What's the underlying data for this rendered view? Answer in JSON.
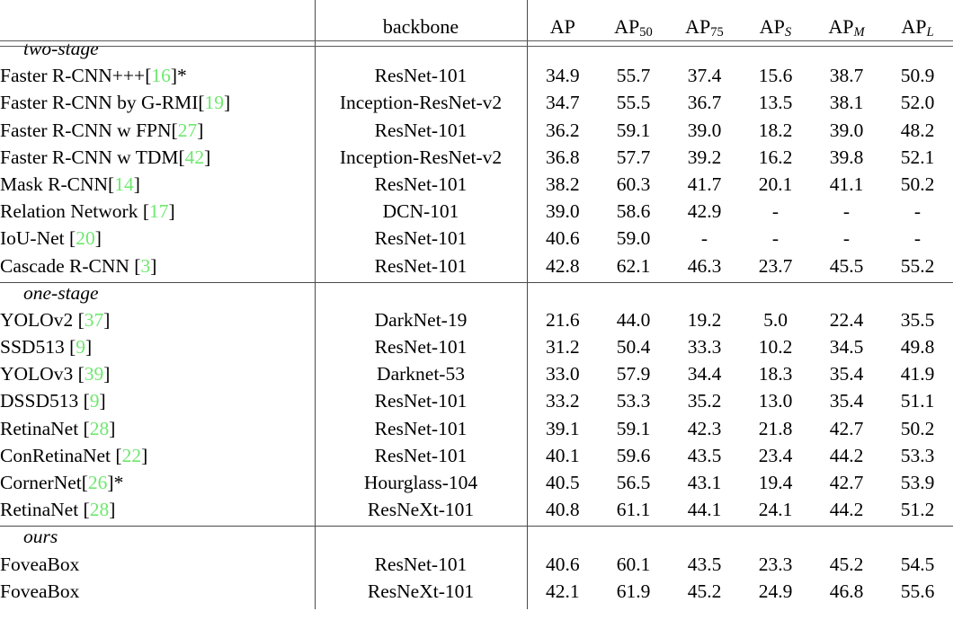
{
  "table": {
    "caption": "",
    "columns": [
      {
        "key": "method",
        "label": "",
        "align": "left"
      },
      {
        "key": "backbone",
        "label": "backbone",
        "align": "center"
      },
      {
        "key": "ap",
        "label": "AP",
        "sub": "",
        "align": "center"
      },
      {
        "key": "ap50",
        "label": "AP",
        "sub": "50",
        "align": "center"
      },
      {
        "key": "ap75",
        "label": "AP",
        "sub": "75",
        "align": "center"
      },
      {
        "key": "aps",
        "label": "AP",
        "sub": "S",
        "align": "center"
      },
      {
        "key": "apm",
        "label": "AP",
        "sub": "M",
        "align": "center"
      },
      {
        "key": "apl",
        "label": "AP",
        "sub": "L",
        "align": "center"
      }
    ],
    "header": {
      "backbone": "backbone",
      "ap": "AP",
      "ap50": "AP",
      "ap50_sub": "50",
      "ap75": "AP",
      "ap75_sub": "75",
      "aps": "AP",
      "aps_sub": "S",
      "apm": "AP",
      "apm_sub": "M",
      "apl": "AP",
      "apl_sub": "L"
    },
    "citation_color": "#6ee86e",
    "rule_color": "#4a4a4a",
    "groups": [
      {
        "label": "two-stage",
        "rows": [
          {
            "name": "Faster R-CNN+++",
            "cite": "16",
            "star": true,
            "space_before_cite": false,
            "backbone": "ResNet-101",
            "ap": "34.9",
            "ap50": "55.7",
            "ap75": "37.4",
            "aps": "15.6",
            "apm": "38.7",
            "apl": "50.9"
          },
          {
            "name": "Faster R-CNN by G-RMI",
            "cite": "19",
            "star": false,
            "space_before_cite": false,
            "backbone": "Inception-ResNet-v2",
            "ap": "34.7",
            "ap50": "55.5",
            "ap75": "36.7",
            "aps": "13.5",
            "apm": "38.1",
            "apl": "52.0"
          },
          {
            "name": "Faster R-CNN w FPN",
            "cite": "27",
            "star": false,
            "space_before_cite": false,
            "backbone": "ResNet-101",
            "ap": "36.2",
            "ap50": "59.1",
            "ap75": "39.0",
            "aps": "18.2",
            "apm": "39.0",
            "apl": "48.2"
          },
          {
            "name": "Faster R-CNN w TDM",
            "cite": "42",
            "star": false,
            "space_before_cite": false,
            "backbone": "Inception-ResNet-v2",
            "ap": "36.8",
            "ap50": "57.7",
            "ap75": "39.2",
            "aps": "16.2",
            "apm": "39.8",
            "apl": "52.1"
          },
          {
            "name": "Mask R-CNN",
            "cite": "14",
            "star": false,
            "space_before_cite": false,
            "backbone": "ResNet-101",
            "ap": "38.2",
            "ap50": "60.3",
            "ap75": "41.7",
            "aps": "20.1",
            "apm": "41.1",
            "apl": "50.2"
          },
          {
            "name": "Relation Network",
            "cite": "17",
            "star": false,
            "space_before_cite": true,
            "backbone": "DCN-101",
            "ap": "39.0",
            "ap50": "58.6",
            "ap75": "42.9",
            "aps": "-",
            "apm": "-",
            "apl": "-"
          },
          {
            "name": "IoU-Net",
            "cite": "20",
            "star": false,
            "space_before_cite": true,
            "backbone": "ResNet-101",
            "ap": "40.6",
            "ap50": "59.0",
            "ap75": "-",
            "aps": "-",
            "apm": "-",
            "apl": "-"
          },
          {
            "name": "Cascade R-CNN",
            "cite": "3",
            "star": false,
            "space_before_cite": true,
            "backbone": "ResNet-101",
            "ap": "42.8",
            "ap50": "62.1",
            "ap75": "46.3",
            "aps": "23.7",
            "apm": "45.5",
            "apl": "55.2"
          }
        ]
      },
      {
        "label": "one-stage",
        "rows": [
          {
            "name": "YOLOv2",
            "cite": "37",
            "star": false,
            "space_before_cite": true,
            "backbone": "DarkNet-19",
            "ap": "21.6",
            "ap50": "44.0",
            "ap75": "19.2",
            "aps": "5.0",
            "apm": "22.4",
            "apl": "35.5"
          },
          {
            "name": "SSD513",
            "cite": "9",
            "star": false,
            "space_before_cite": true,
            "backbone": "ResNet-101",
            "ap": "31.2",
            "ap50": "50.4",
            "ap75": "33.3",
            "aps": "10.2",
            "apm": "34.5",
            "apl": "49.8"
          },
          {
            "name": "YOLOv3",
            "cite": "39",
            "star": false,
            "space_before_cite": true,
            "backbone": "Darknet-53",
            "ap": "33.0",
            "ap50": "57.9",
            "ap75": "34.4",
            "aps": "18.3",
            "apm": "35.4",
            "apl": "41.9"
          },
          {
            "name": "DSSD513",
            "cite": "9",
            "star": false,
            "space_before_cite": true,
            "backbone": "ResNet-101",
            "ap": "33.2",
            "ap50": "53.3",
            "ap75": "35.2",
            "aps": "13.0",
            "apm": "35.4",
            "apl": "51.1"
          },
          {
            "name": "RetinaNet",
            "cite": "28",
            "star": false,
            "space_before_cite": true,
            "backbone": "ResNet-101",
            "ap": "39.1",
            "ap50": "59.1",
            "ap75": "42.3",
            "aps": "21.8",
            "apm": "42.7",
            "apl": "50.2"
          },
          {
            "name": "ConRetinaNet",
            "cite": "22",
            "star": false,
            "space_before_cite": true,
            "backbone": "ResNet-101",
            "ap": "40.1",
            "ap50": "59.6",
            "ap75": "43.5",
            "aps": "23.4",
            "apm": "44.2",
            "apl": "53.3"
          },
          {
            "name": "CornerNet",
            "cite": "26",
            "star": true,
            "space_before_cite": false,
            "backbone": "Hourglass-104",
            "ap": "40.5",
            "ap50": "56.5",
            "ap75": "43.1",
            "aps": "19.4",
            "apm": "42.7",
            "apl": "53.9"
          },
          {
            "name": "RetinaNet",
            "cite": "28",
            "star": false,
            "space_before_cite": true,
            "backbone": "ResNeXt-101",
            "ap": "40.8",
            "ap50": "61.1",
            "ap75": "44.1",
            "aps": "24.1",
            "apm": "44.2",
            "apl": "51.2"
          }
        ]
      },
      {
        "label": "ours",
        "rows": [
          {
            "name": "FoveaBox",
            "cite": "",
            "star": false,
            "space_before_cite": false,
            "backbone": "ResNet-101",
            "ap": "40.6",
            "ap50": "60.1",
            "ap75": "43.5",
            "aps": "23.3",
            "apm": "45.2",
            "apl": "54.5"
          },
          {
            "name": "FoveaBox",
            "cite": "",
            "star": false,
            "space_before_cite": false,
            "backbone": "ResNeXt-101",
            "ap": "42.1",
            "ap50": "61.9",
            "ap75": "45.2",
            "aps": "24.9",
            "apm": "46.8",
            "apl": "55.6"
          }
        ]
      }
    ]
  }
}
